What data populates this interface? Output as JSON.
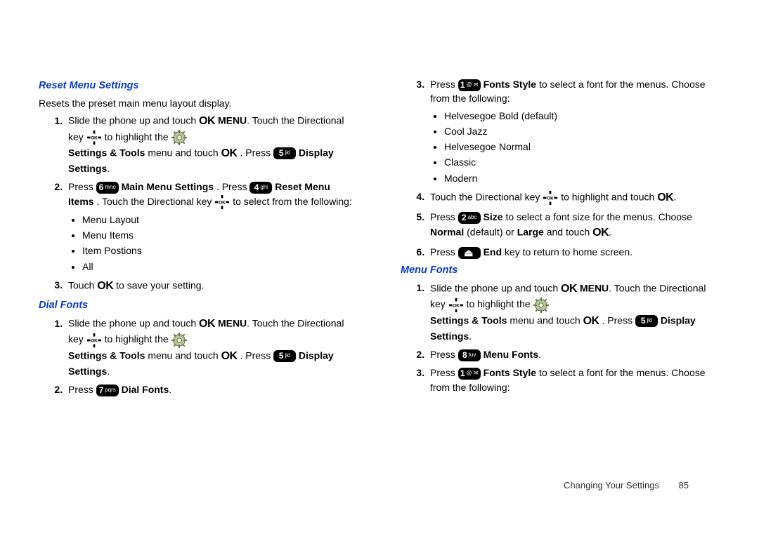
{
  "footer": {
    "section": "Changing Your Settings",
    "page": "85"
  },
  "icons": {
    "ok": "OK",
    "key5": {
      "num": "5",
      "sub": "jkl"
    },
    "key6": {
      "num": "6",
      "sub": "mno"
    },
    "key4": {
      "num": "4",
      "sub": "ghi"
    },
    "key7": {
      "num": "7",
      "sub": "pqrs"
    },
    "key1": {
      "num": "1",
      "sub": " @ ✉"
    },
    "key2": {
      "num": "2",
      "sub": "abc"
    },
    "key8": {
      "num": "8",
      "sub": "tuv"
    },
    "keyEnd": {
      "num": "⏏",
      "sub": ""
    }
  },
  "left": {
    "sec1": {
      "title": "Reset Menu Settings",
      "intro": "Resets the preset main menu layout display.",
      "step1a": "Slide the phone up and touch ",
      "step1b": " MENU",
      "step1c": ". Touch the Directional key ",
      "step1d": " to highlight the ",
      "step1e": "Settings & Tools",
      "step1f": " menu and touch ",
      "step1g": ". Press ",
      "step1h": "Display Settings",
      "step1i": ".",
      "step2a": "Press ",
      "step2b": " Main Menu Settings",
      "step2c": ". Press ",
      "step2d": " Reset Menu Items",
      "step2e": ". Touch the Directional key ",
      "step2f": " to select from the following:",
      "bullets": [
        "Menu Layout",
        "Menu Items",
        "Item Postions",
        "All"
      ],
      "step3a": "Touch ",
      "step3b": " to save your setting."
    },
    "sec2": {
      "title": "Dial Fonts",
      "step1a": "Slide the phone up and touch ",
      "step1b": " MENU",
      "step1c": ". Touch the Directional key ",
      "step1d": " to highlight the ",
      "step1e": "Settings & Tools",
      "step1f": " menu and touch ",
      "step1g": ". Press ",
      "step1h": "Display Settings",
      "step1i": ".",
      "step2a": "Press ",
      "step2b": " Dial Fonts",
      "step2c": "."
    }
  },
  "right": {
    "cont": {
      "step3a": "Press ",
      "step3b": " Fonts Style",
      "step3c": " to select a font for the menus. Choose from the following:",
      "bullets": [
        "Helvesegoe Bold (default)",
        "Cool Jazz",
        "Helvesegoe Normal",
        "Classic",
        "Modern"
      ],
      "step4a": "Touch the Directional key ",
      "step4b": " to highlight and touch ",
      "step4c": ".",
      "step5a": "Press ",
      "step5b": " Size",
      "step5c": " to select a font size for the menus. Choose ",
      "step5d": "Normal",
      "step5e": " (default) or ",
      "step5f": "Large",
      "step5g": " and touch ",
      "step5h": ".",
      "step6a": "Press ",
      "step6b": " End",
      "step6c": " key to return to home screen."
    },
    "sec2": {
      "title": "Menu Fonts",
      "step1a": "Slide the phone up and touch ",
      "step1b": " MENU",
      "step1c": ". Touch the Directional key ",
      "step1d": " to highlight the ",
      "step1e": "Settings & Tools",
      "step1f": " menu and touch ",
      "step1g": ". Press ",
      "step1h": "Display Settings",
      "step1i": ".",
      "step2a": "Press ",
      "step2b": " Menu Fonts",
      "step2c": ".",
      "step3a": "Press ",
      "step3b": " Fonts Style",
      "step3c": " to select a font for the menus. Choose from the following:"
    }
  }
}
